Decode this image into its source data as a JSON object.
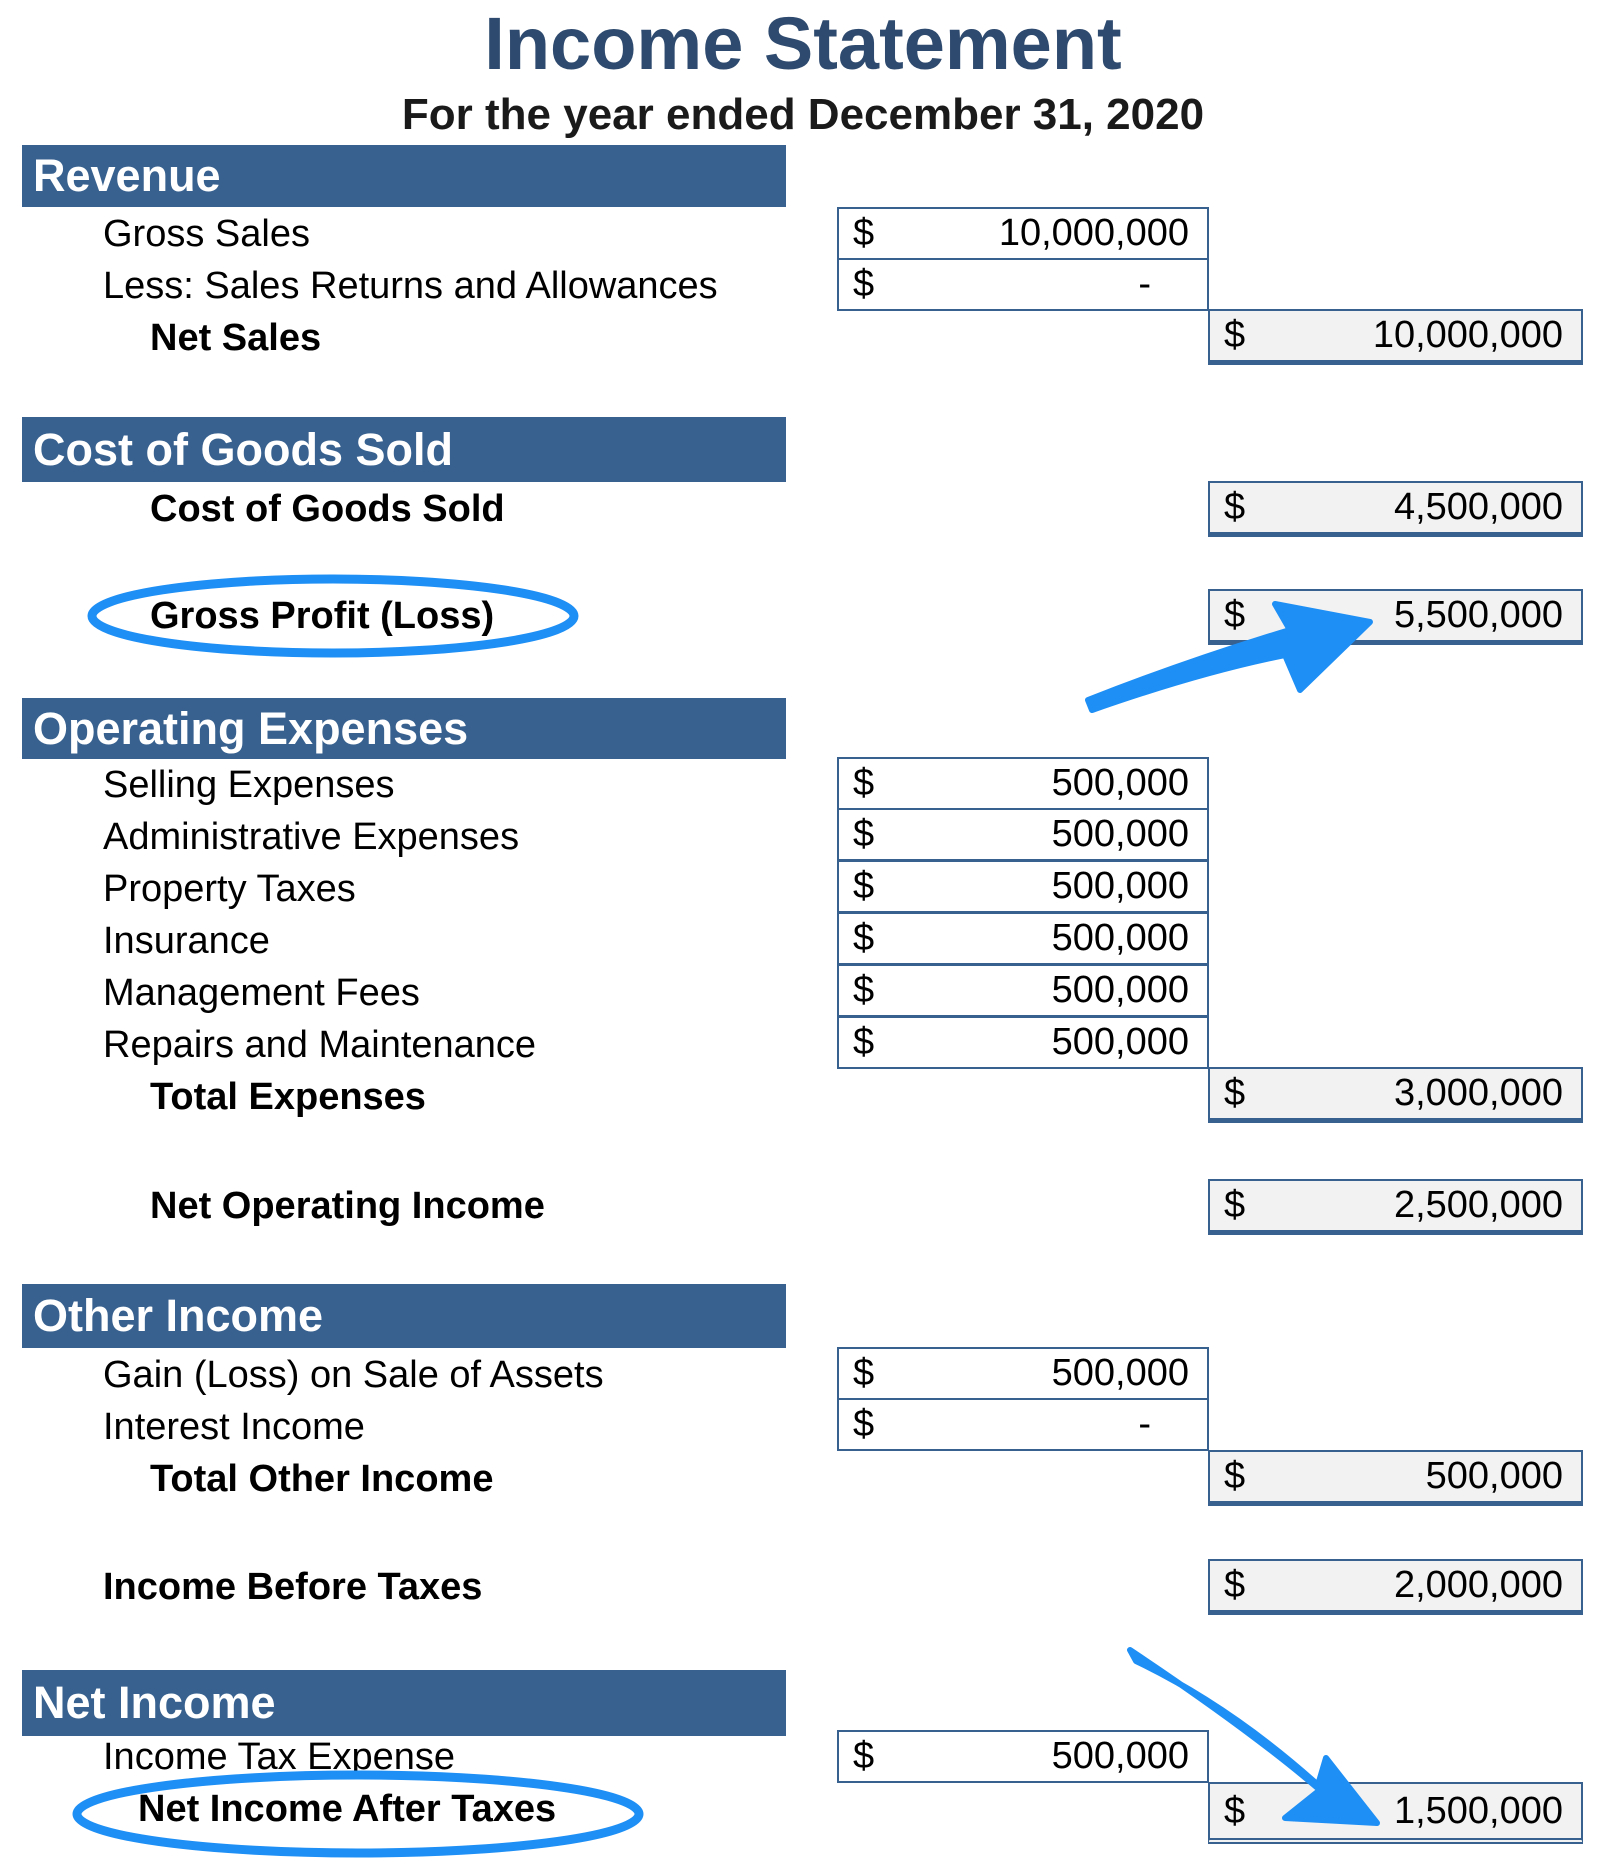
{
  "header": {
    "title": "Income Statement",
    "subtitle": "For the year ended December 31, 2020"
  },
  "colors": {
    "title": "#2e4a6e",
    "section_header_bg": "#38618f",
    "total_fill": "#f2f2f2",
    "annotation": "#1e8ff5"
  },
  "currency_symbol": "$",
  "revenue": {
    "header": "Revenue",
    "items": [
      {
        "label": "Gross Sales",
        "amount": "10,000,000"
      },
      {
        "label": "Less: Sales Returns and Allowances",
        "amount": "-"
      }
    ],
    "total": {
      "label": "Net Sales",
      "amount": "10,000,000"
    }
  },
  "cogs": {
    "header": "Cost of Goods Sold",
    "total": {
      "label": "Cost of Goods Sold",
      "amount": "4,500,000"
    }
  },
  "gross_profit": {
    "label": "Gross Profit (Loss)",
    "amount": "5,500,000",
    "highlighted": true
  },
  "operating_expenses": {
    "header": "Operating Expenses",
    "items": [
      {
        "label": "Selling Expenses",
        "amount": "500,000"
      },
      {
        "label": "Administrative Expenses",
        "amount": "500,000"
      },
      {
        "label": "Property Taxes",
        "amount": "500,000"
      },
      {
        "label": "Insurance",
        "amount": "500,000"
      },
      {
        "label": "Management Fees",
        "amount": "500,000"
      },
      {
        "label": "Repairs and Maintenance",
        "amount": "500,000"
      }
    ],
    "total": {
      "label": "Total Expenses",
      "amount": "3,000,000"
    }
  },
  "net_operating_income": {
    "label": "Net Operating Income",
    "amount": "2,500,000"
  },
  "other_income": {
    "header": "Other Income",
    "items": [
      {
        "label": "Gain (Loss) on Sale of Assets",
        "amount": "500,000"
      },
      {
        "label": "Interest Income",
        "amount": "-"
      }
    ],
    "total": {
      "label": "Total Other Income",
      "amount": "500,000"
    }
  },
  "income_before_taxes": {
    "label": "Income Before Taxes",
    "amount": "2,000,000"
  },
  "net_income": {
    "header": "Net Income",
    "items": [
      {
        "label": "Income Tax Expense",
        "amount": "500,000"
      }
    ],
    "total": {
      "label": "Net Income After Taxes",
      "amount": "1,500,000",
      "highlighted": true
    }
  }
}
